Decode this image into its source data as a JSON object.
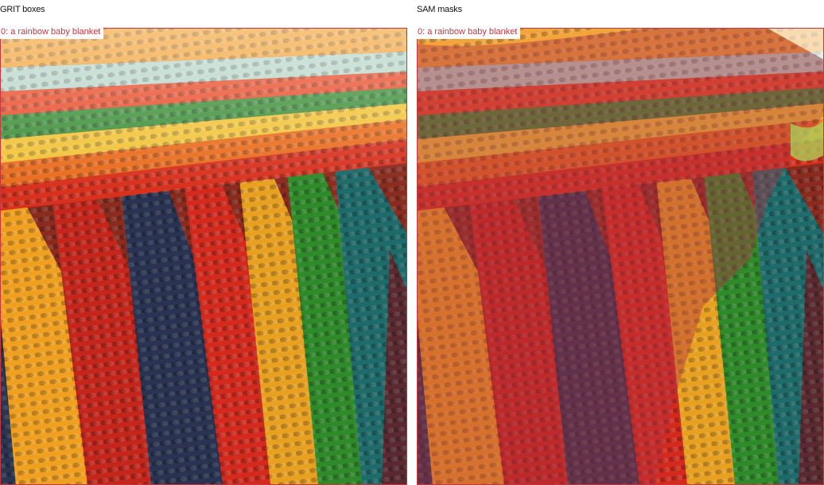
{
  "panels": {
    "grit": {
      "title": "GRIT boxes",
      "label": "0: a rainbow baby blanket"
    },
    "sam": {
      "title": "SAM masks",
      "label": "0: a rainbow baby blanket"
    }
  },
  "colors": {
    "box_outline": "#c9343f",
    "mask_tint": "#b03040",
    "label_text": "#c9343f"
  },
  "image_content": "rainbow-crochet-blanket-photo"
}
